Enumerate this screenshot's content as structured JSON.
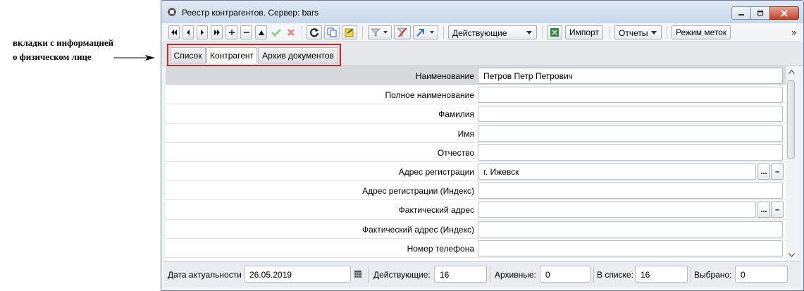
{
  "annotation": {
    "line1": "вкладки с информацией",
    "line2": "о физическом лице"
  },
  "window": {
    "title": "Реестр контрагентов. Сервер: bars"
  },
  "toolbar": {
    "filter_combo": "Действующие",
    "import_label": "Импорт",
    "reports_label": "Отчеты",
    "marks_mode_label": "Режим меток",
    "more_label": "»"
  },
  "tabs": [
    {
      "label": "Список",
      "active": false
    },
    {
      "label": "Контрагент",
      "active": true
    },
    {
      "label": "Архив документов",
      "active": false
    }
  ],
  "form": {
    "rows": [
      {
        "label": "Наименование",
        "value": ""
      },
      {
        "label": "Полное наименование",
        "value": ""
      },
      {
        "label": "Фамилия",
        "value": ""
      },
      {
        "label": "Имя",
        "value": ""
      },
      {
        "label": "Отчество",
        "value": ""
      },
      {
        "label": "Адрес регистрации",
        "value": ""
      },
      {
        "label": "Адрес регистрации (Индекс)",
        "value": ""
      },
      {
        "label": "Фактический адрес",
        "value": ""
      },
      {
        "label": "Фактический адрес (Индекс)",
        "value": ""
      },
      {
        "label": "Номер телефона",
        "value": ""
      }
    ],
    "values": {
      "name": "Петров Петр Петрович",
      "reg_address": "г. Ижевск"
    },
    "lookup_button": "...",
    "clear_button": "–"
  },
  "status": {
    "date_label": "Дата актуальности",
    "date_value": "26.05.2019",
    "active_label": "Действующие:",
    "active_value": "16",
    "archived_label": "Архивные:",
    "archived_value": "0",
    "inlist_label": "В списке:",
    "inlist_value": "16",
    "selected_label": "Выбрано:",
    "selected_value": "0"
  },
  "colors": {
    "highlight_border": "#d9201c",
    "selected_row": "#d6d8db"
  }
}
